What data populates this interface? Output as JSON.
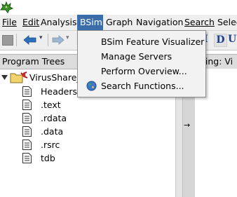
{
  "menubar": {
    "items": [
      {
        "label": "File"
      },
      {
        "label": "Edit"
      },
      {
        "label": "Analysis"
      },
      {
        "label": "BSim"
      },
      {
        "label": "Graph"
      },
      {
        "label": "Navigation"
      },
      {
        "label": "Search"
      },
      {
        "label": "Select"
      }
    ]
  },
  "bsim_menu": {
    "items": [
      {
        "label": "BSim Feature Visualizer"
      },
      {
        "label": "Manage Servers"
      },
      {
        "label": "Perform Overview..."
      },
      {
        "label": "Search Functions...",
        "icon": "globe-icon"
      }
    ]
  },
  "toolbar": {
    "letters": [
      "I",
      "D",
      "U"
    ]
  },
  "program_trees": {
    "title": "Program Trees",
    "root": "VirusShare_",
    "children": [
      "Headers",
      ".text",
      ".rdata",
      ".data",
      ".rsrc",
      "tdb"
    ]
  },
  "listing": {
    "title": "isting: Vi"
  },
  "colors": {
    "menu_highlight": "#3b6ea8",
    "menu_bg": "#eeeeee",
    "panel_header": "#dcdcdc"
  }
}
